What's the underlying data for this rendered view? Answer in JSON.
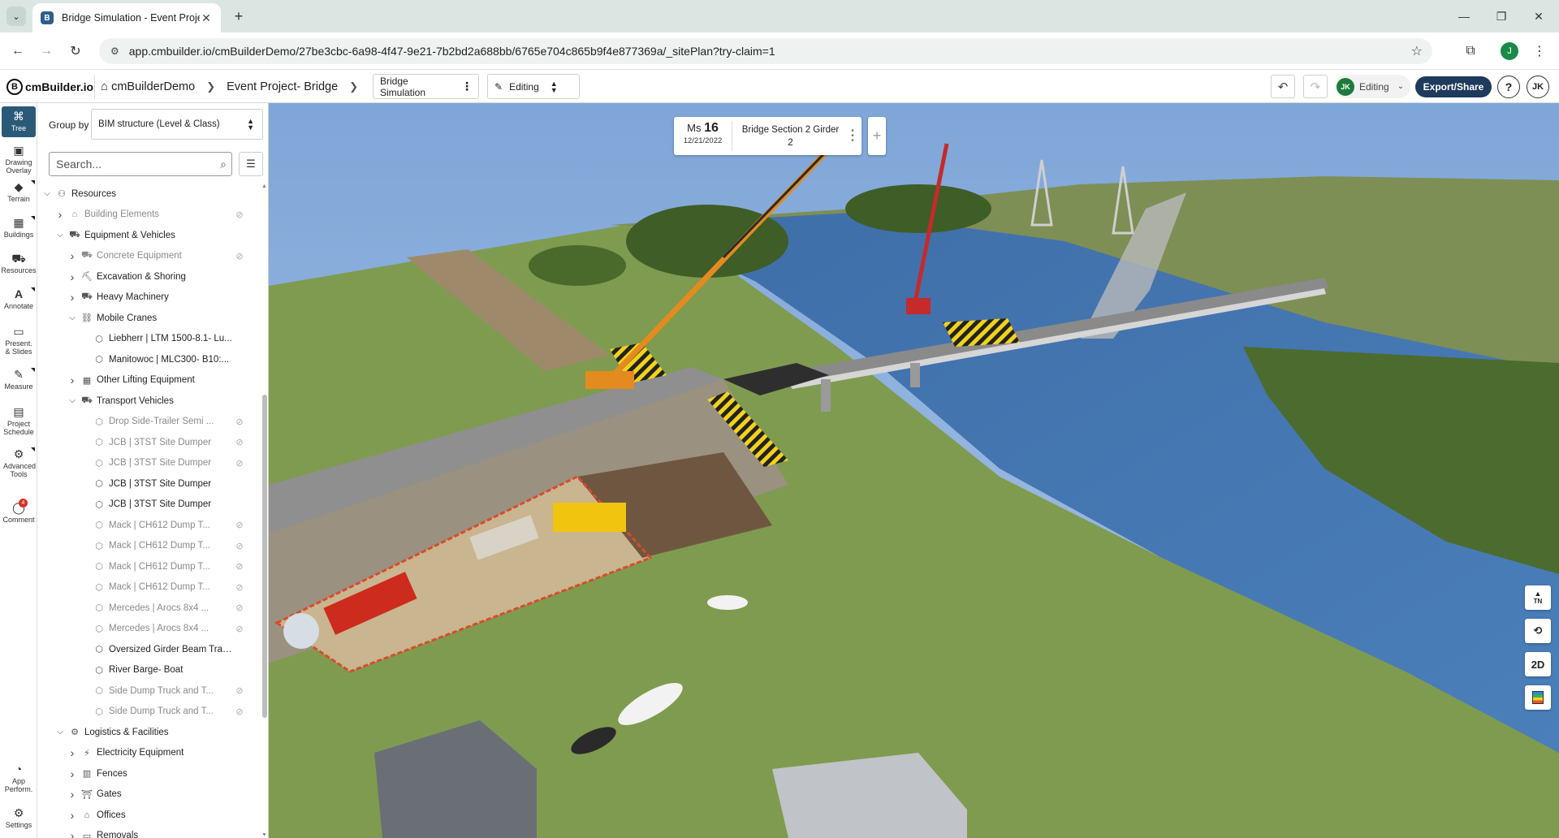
{
  "browser": {
    "tab_title": "Bridge Simulation - Event Proje",
    "favicon_letter": "B",
    "url": "app.cmbuilder.io/cmBuilderDemo/27be3cbc-6a98-4f47-9e21-7b2bd2a688bb/6765e704c865b9f4e877369a/_sitePlan?try-claim=1",
    "profile_letter": "J"
  },
  "header": {
    "logo": "cmBuilder.io",
    "logo_letter": "B",
    "breadcrumb": [
      "cmBuilderDemo",
      "Event Project- Bridge"
    ],
    "simulation": "Bridge Simulation",
    "mode": "Editing",
    "status_avatar": "JK",
    "status_label": "Editing",
    "export_label": "Export/Share",
    "help": "?",
    "user_initials": "JK"
  },
  "rail": [
    {
      "label": "Tree",
      "icon": "tree-icon",
      "glyph": "⌘"
    },
    {
      "label": "Drawing Overlay",
      "icon": "image-icon",
      "glyph": "▣"
    },
    {
      "label": "Terrain",
      "icon": "terrain-icon",
      "glyph": "◆"
    },
    {
      "label": "Buildings",
      "icon": "buildings-icon",
      "glyph": "▦"
    },
    {
      "label": "Resources",
      "icon": "resources-icon",
      "glyph": "⛟"
    },
    {
      "label": "Annotate",
      "icon": "annotate-icon",
      "glyph": "A"
    },
    {
      "label": "Present. & Slides",
      "icon": "present-icon",
      "glyph": "▭"
    },
    {
      "label": "Measure",
      "icon": "measure-icon",
      "glyph": "✎"
    },
    {
      "label": "Project Schedule",
      "icon": "schedule-icon",
      "glyph": "▤"
    },
    {
      "label": "Advanced Tools",
      "icon": "tools-icon",
      "glyph": "⚙"
    },
    {
      "label": "Comment",
      "icon": "comment-icon",
      "glyph": "◯",
      "badge": "4"
    },
    {
      "label": "App Perform.",
      "icon": "performance-icon",
      "glyph": "◔"
    },
    {
      "label": "Settings",
      "icon": "settings-icon",
      "glyph": "⚙"
    }
  ],
  "panel": {
    "group_by_label": "Group by",
    "group_by_value": "BIM structure (Level & Class)",
    "search_placeholder": "Search...",
    "tree": [
      {
        "label": "Resources",
        "level": 0,
        "state": "open",
        "icon": "⚇",
        "dim": false,
        "hidden": false
      },
      {
        "label": "Building Elements",
        "level": 1,
        "state": "closed",
        "icon": "⌂",
        "dim": true,
        "hidden": true
      },
      {
        "label": "Equipment & Vehicles",
        "level": 1,
        "state": "open",
        "icon": "⛟",
        "dim": false,
        "hidden": false
      },
      {
        "label": "Concrete Equipment",
        "level": 2,
        "state": "closed",
        "icon": "⛟",
        "dim": true,
        "hidden": true
      },
      {
        "label": "Excavation & Shoring",
        "level": 2,
        "state": "closed",
        "icon": "⛏",
        "dim": false,
        "hidden": false
      },
      {
        "label": "Heavy Machinery",
        "level": 2,
        "state": "closed",
        "icon": "⛟",
        "dim": false,
        "hidden": false
      },
      {
        "label": "Mobile Cranes",
        "level": 2,
        "state": "open",
        "icon": "⛓",
        "dim": false,
        "hidden": false
      },
      {
        "label": "Liebherr | LTM 1500-8.1- Lu...",
        "level": 3,
        "state": "leaf",
        "icon": "⬡",
        "dim": false,
        "hidden": false
      },
      {
        "label": "Manitowoc | MLC300- B10:...",
        "level": 3,
        "state": "leaf",
        "icon": "⬡",
        "dim": false,
        "hidden": false
      },
      {
        "label": "Other Lifting Equipment",
        "level": 2,
        "state": "closed",
        "icon": "▦",
        "dim": false,
        "hidden": false
      },
      {
        "label": "Transport Vehicles",
        "level": 2,
        "state": "open",
        "icon": "⛟",
        "dim": false,
        "hidden": false
      },
      {
        "label": "Drop Side-Trailer Semi ...",
        "level": 3,
        "state": "leaf",
        "icon": "⬡",
        "dim": true,
        "hidden": true
      },
      {
        "label": "JCB | 3TST Site Dumper",
        "level": 3,
        "state": "leaf",
        "icon": "⬡",
        "dim": true,
        "hidden": true
      },
      {
        "label": "JCB | 3TST Site Dumper",
        "level": 3,
        "state": "leaf",
        "icon": "⬡",
        "dim": true,
        "hidden": true
      },
      {
        "label": "JCB | 3TST Site Dumper",
        "level": 3,
        "state": "leaf",
        "icon": "⬡",
        "dim": false,
        "hidden": false
      },
      {
        "label": "JCB | 3TST Site Dumper",
        "level": 3,
        "state": "leaf",
        "icon": "⬡",
        "dim": false,
        "hidden": false
      },
      {
        "label": "Mack | CH612 Dump T...",
        "level": 3,
        "state": "leaf",
        "icon": "⬡",
        "dim": true,
        "hidden": true
      },
      {
        "label": "Mack | CH612 Dump T...",
        "level": 3,
        "state": "leaf",
        "icon": "⬡",
        "dim": true,
        "hidden": true
      },
      {
        "label": "Mack | CH612 Dump T...",
        "level": 3,
        "state": "leaf",
        "icon": "⬡",
        "dim": true,
        "hidden": true
      },
      {
        "label": "Mack | CH612 Dump T...",
        "level": 3,
        "state": "leaf",
        "icon": "⬡",
        "dim": true,
        "hidden": true
      },
      {
        "label": "Mercedes | Arocs 8x4 ...",
        "level": 3,
        "state": "leaf",
        "icon": "⬡",
        "dim": true,
        "hidden": true
      },
      {
        "label": "Mercedes | Arocs 8x4 ...",
        "level": 3,
        "state": "leaf",
        "icon": "⬡",
        "dim": true,
        "hidden": true
      },
      {
        "label": "Oversized Girder Beam Tran...",
        "level": 3,
        "state": "leaf",
        "icon": "⬡",
        "dim": false,
        "hidden": false
      },
      {
        "label": "River Barge- Boat",
        "level": 3,
        "state": "leaf",
        "icon": "⬡",
        "dim": false,
        "hidden": false
      },
      {
        "label": "Side Dump Truck and T...",
        "level": 3,
        "state": "leaf",
        "icon": "⬡",
        "dim": true,
        "hidden": true
      },
      {
        "label": "Side Dump Truck and T...",
        "level": 3,
        "state": "leaf",
        "icon": "⬡",
        "dim": true,
        "hidden": true
      },
      {
        "label": "Logistics & Facilities",
        "level": 1,
        "state": "open",
        "icon": "⚙",
        "dim": false,
        "hidden": false
      },
      {
        "label": "Electricity Equipment",
        "level": 2,
        "state": "closed",
        "icon": "⚡",
        "dim": false,
        "hidden": false
      },
      {
        "label": "Fences",
        "level": 2,
        "state": "closed",
        "icon": "▥",
        "dim": false,
        "hidden": false
      },
      {
        "label": "Gates",
        "level": 2,
        "state": "closed",
        "icon": "⛩",
        "dim": false,
        "hidden": false
      },
      {
        "label": "Offices",
        "level": 2,
        "state": "closed",
        "icon": "⌂",
        "dim": false,
        "hidden": false
      },
      {
        "label": "Removals",
        "level": 2,
        "state": "closed",
        "icon": "▭",
        "dim": false,
        "hidden": false
      }
    ]
  },
  "milestone": {
    "prefix": "Ms",
    "number": "16",
    "date": "12/21/2022",
    "title": "Bridge Section 2 Girder",
    "subtitle": "2"
  },
  "view_controls": {
    "north": "TN",
    "mode_2d": "2D"
  }
}
